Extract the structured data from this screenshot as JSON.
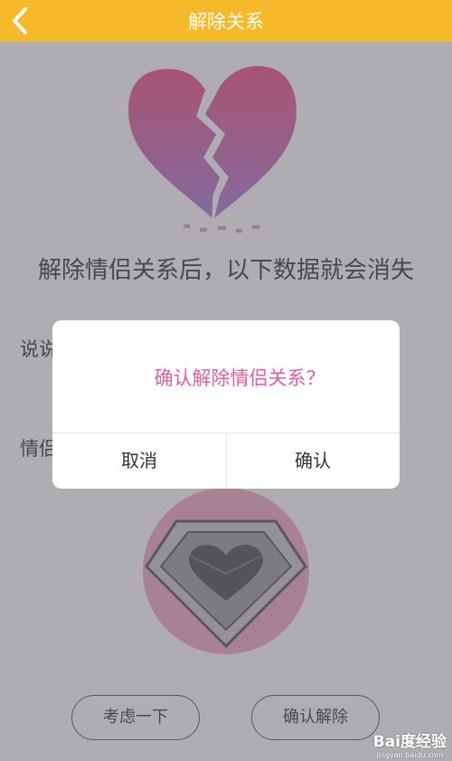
{
  "header": {
    "title": "解除关系",
    "back_icon": "chevron-left-icon",
    "background": "#f5b92a"
  },
  "main": {
    "headline": "解除情侣关系后，以下数据就会消失",
    "rows": [
      {
        "label": "说说"
      },
      {
        "label": "情侣"
      }
    ],
    "buttons": {
      "reconsider": "考虑一下",
      "confirm_remove": "确认解除"
    },
    "images": {
      "hero": "broken-heart-icon",
      "gem": "diamond-heart-icon"
    }
  },
  "dialog": {
    "message": "确认解除情侣关系？",
    "cancel": "取消",
    "confirm": "确认",
    "message_color": "#e05f9e"
  },
  "watermark": {
    "main": "Bai度经验",
    "sub": "jingyan.baidu.com"
  }
}
